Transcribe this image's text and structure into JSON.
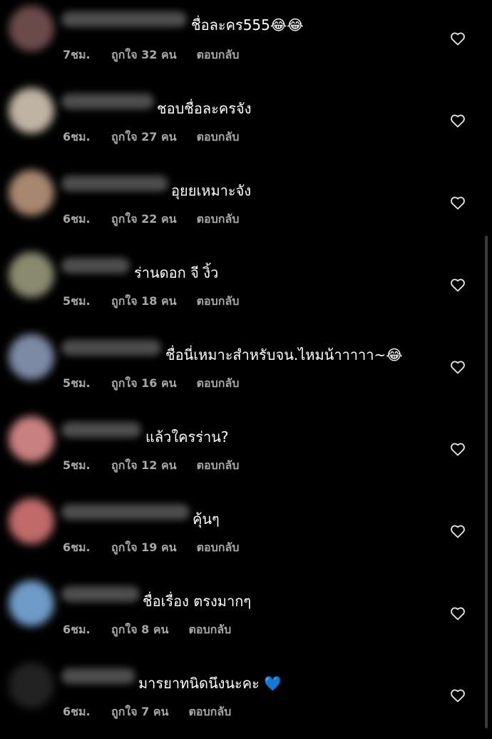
{
  "comments": [
    {
      "text": "ชื่อละคร555😂😂",
      "time": "7ชม.",
      "likes": "ถูกใจ 32 คน",
      "reply": "ตอบกลับ",
      "avatar_color": "#6b4a4a"
    },
    {
      "text": "ชอบชื่อละครจัง",
      "time": "6ชม.",
      "likes": "ถูกใจ 27 คน",
      "reply": "ตอบกลับ",
      "avatar_color": "#bfb3a3"
    },
    {
      "text": "อุยยเหมาะจัง",
      "time": "6ชม.",
      "likes": "ถูกใจ 22 คน",
      "reply": "ตอบกลับ",
      "avatar_color": "#a88770"
    },
    {
      "text": "ร่านดอก จี งิ้ว",
      "time": "5ชม.",
      "likes": "ถูกใจ 18 คน",
      "reply": "ตอบกลับ",
      "avatar_color": "#8a8a70"
    },
    {
      "text": "ชื่อนี่เหมาะสำหรับจน.ไหมน้าาาาา~😂",
      "time": "5ชม.",
      "likes": "ถูกใจ 16 คน",
      "reply": "ตอบกลับ",
      "avatar_color": "#7d8aa5"
    },
    {
      "text": "แล้วใครร่าน?",
      "time": "5ชม.",
      "likes": "ถูกใจ 12 คน",
      "reply": "ตอบกลับ",
      "avatar_color": "#c98080"
    },
    {
      "text": "คุ้นๆ",
      "time": "6ชม.",
      "likes": "ถูกใจ 19 คน",
      "reply": "ตอบกลับ",
      "avatar_color": "#c06a6a"
    },
    {
      "text": "ชื่อเรื่อง ตรงมากๆ",
      "time": "6ชม.",
      "likes": "ถูกใจ 8 คน",
      "reply": "ตอบกลับ",
      "avatar_color": "#6f9bc8"
    },
    {
      "text": "มารยาทนิดนึงนะคะ 💙",
      "time": "6ชม.",
      "likes": "ถูกใจ 7 คน",
      "reply": "ตอบกลับ",
      "avatar_color": "#222222"
    }
  ]
}
